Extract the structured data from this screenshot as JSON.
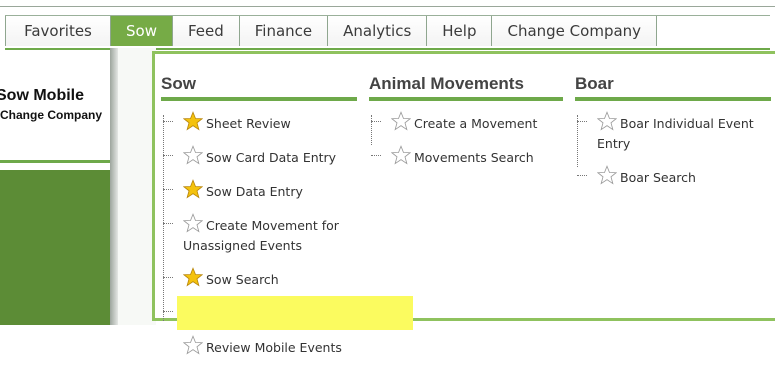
{
  "nav": {
    "items": [
      {
        "label": "Favorites",
        "active": false
      },
      {
        "label": "Sow",
        "active": true
      },
      {
        "label": "Feed",
        "active": false
      },
      {
        "label": "Finance",
        "active": false
      },
      {
        "label": "Analytics",
        "active": false
      },
      {
        "label": "Help",
        "active": false
      },
      {
        "label": "Change Company",
        "active": false
      }
    ]
  },
  "left": {
    "title": "Sow Mobile",
    "subtitle": "Change Company"
  },
  "menu": {
    "sow": {
      "heading": "Sow",
      "items": [
        {
          "label": "Sheet Review",
          "favorite": true
        },
        {
          "label": "Sow Card Data Entry",
          "favorite": false
        },
        {
          "label": "Sow Data Entry",
          "favorite": true
        },
        {
          "label": "Create Movement for Unassigned Events",
          "favorite": false
        },
        {
          "label": "Sow Search",
          "favorite": true
        },
        {
          "label": "Review Mobile Events",
          "favorite": false,
          "highlighted": true
        }
      ]
    },
    "animal_movements": {
      "heading": "Animal Movements",
      "items": [
        {
          "label": "Create a Movement",
          "favorite": false
        },
        {
          "label": "Movements Search",
          "favorite": false
        }
      ]
    },
    "boar": {
      "heading": "Boar",
      "items": [
        {
          "label": "Boar Individual Event Entry",
          "favorite": false
        },
        {
          "label": "Boar Search",
          "favorite": false
        }
      ]
    }
  },
  "colors": {
    "accent_green": "#6ea94a",
    "active_tab": "#76ab46",
    "star_filled": "#f4c20d",
    "highlight": "#fbfb5f"
  }
}
